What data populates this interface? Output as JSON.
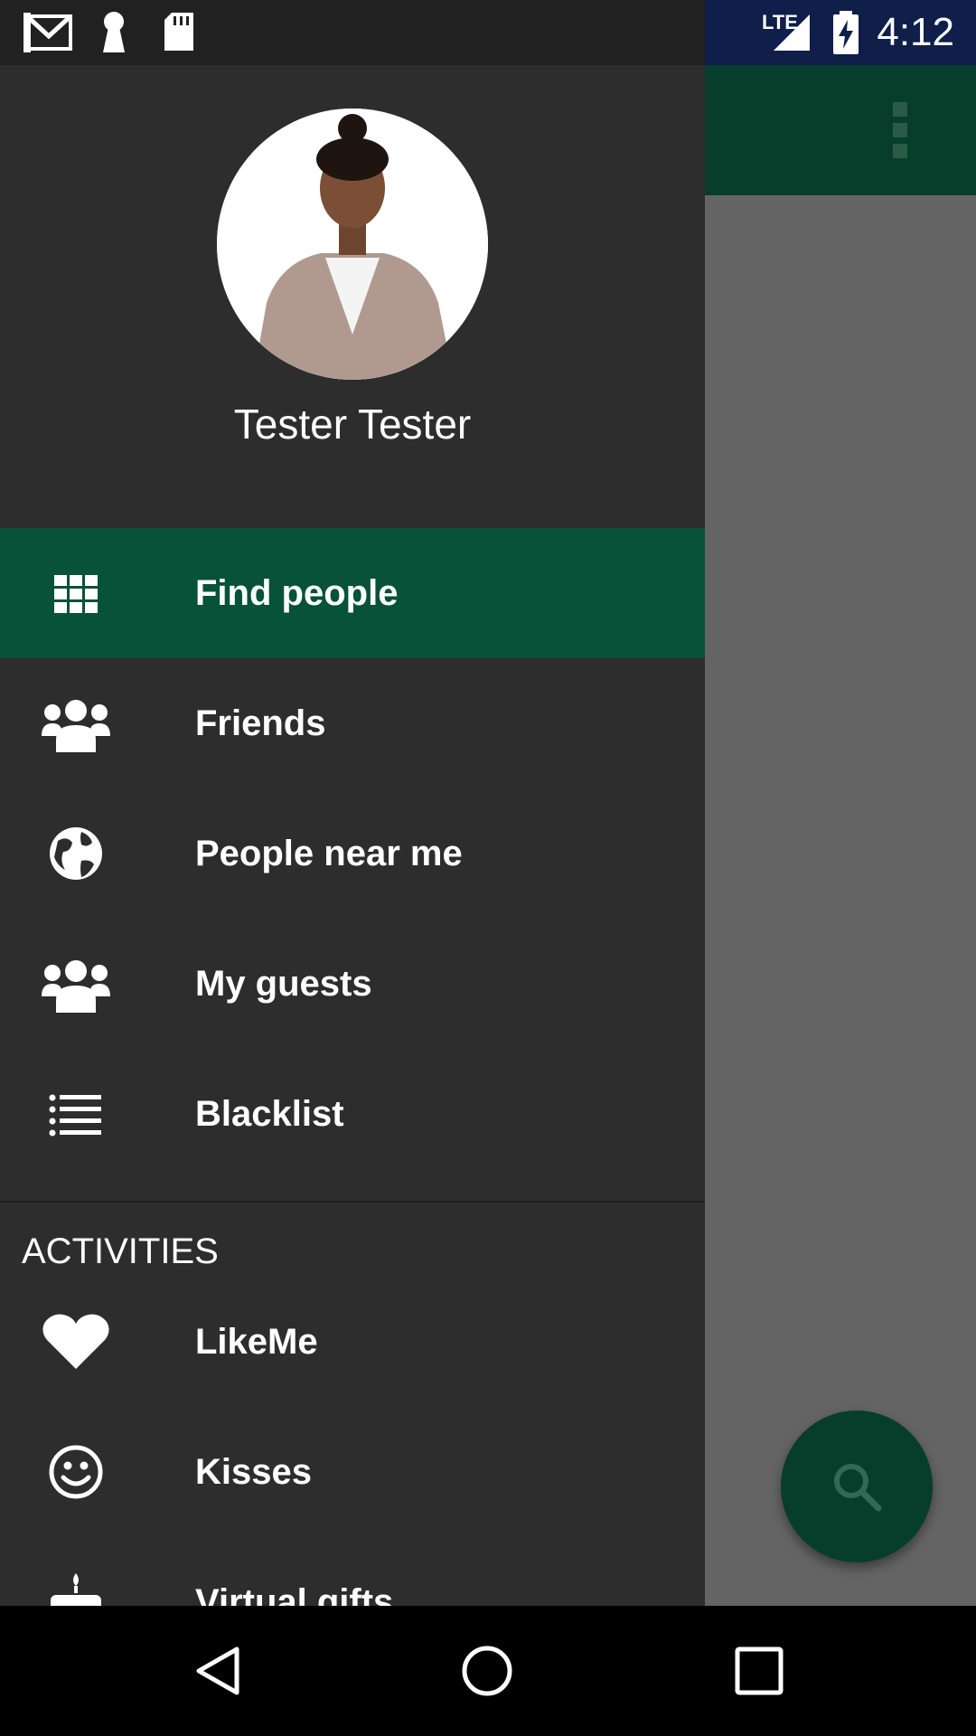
{
  "status_bar": {
    "time": "4:12",
    "network": "LTE",
    "icons": [
      "gmail-icon",
      "keyhole-icon",
      "sd-card-icon",
      "signal-icon",
      "battery-charging-icon"
    ]
  },
  "app": {
    "menu_icon": "overflow-menu-icon",
    "fab_icon": "search-icon"
  },
  "drawer": {
    "user_name": "Tester Tester",
    "items": [
      {
        "label": "Find people",
        "icon": "grid-icon",
        "active": true
      },
      {
        "label": "Friends",
        "icon": "group-icon"
      },
      {
        "label": "People near me",
        "icon": "globe-icon"
      },
      {
        "label": "My guests",
        "icon": "group-icon"
      },
      {
        "label": "Blacklist",
        "icon": "list-icon"
      }
    ],
    "section_header": "ACTIVITIES",
    "activity_items": [
      {
        "label": "LikeMe",
        "icon": "heart-icon"
      },
      {
        "label": "Kisses",
        "icon": "smiley-icon"
      },
      {
        "label": "Virtual gifts",
        "icon": "gift-icon"
      }
    ]
  },
  "colors": {
    "accent": "#075239",
    "drawer_bg": "#2d2d2d",
    "toolbar": "#073d2b"
  },
  "system_nav": [
    "back-icon",
    "home-icon",
    "recents-icon"
  ]
}
